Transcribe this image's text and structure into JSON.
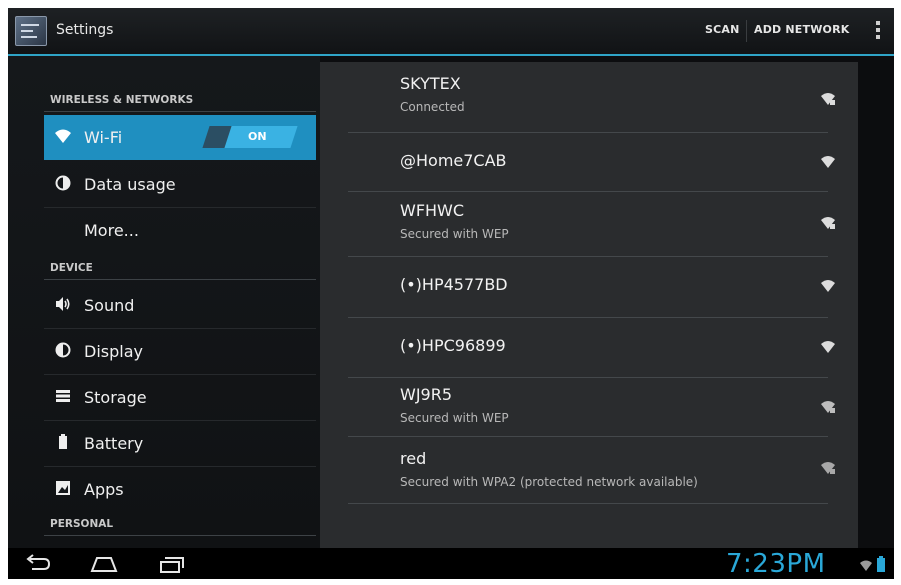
{
  "action_bar": {
    "title": "Settings",
    "scan_label": "SCAN",
    "add_network_label": "ADD NETWORK"
  },
  "sidebar": {
    "sections": [
      {
        "header": "WIRELESS & NETWORKS"
      },
      {
        "header": "DEVICE"
      },
      {
        "header": "PERSONAL"
      }
    ],
    "items": [
      {
        "label": "Wi-Fi",
        "icon": "wifi-icon",
        "selected": true
      },
      {
        "label": "Data usage",
        "icon": "data-usage-icon"
      },
      {
        "label": "More..."
      },
      {
        "label": "Sound",
        "icon": "speaker-icon"
      },
      {
        "label": "Display",
        "icon": "display-icon"
      },
      {
        "label": "Storage",
        "icon": "storage-icon"
      },
      {
        "label": "Battery",
        "icon": "battery-icon"
      },
      {
        "label": "Apps",
        "icon": "apps-icon"
      }
    ],
    "wifi_toggle": {
      "label": "ON",
      "state": "on"
    }
  },
  "networks": [
    {
      "name": "SKYTEX",
      "status": "Connected",
      "secured": true
    },
    {
      "name": "@Home7CAB",
      "status": "",
      "secured": false
    },
    {
      "name": "WFHWC",
      "status": "Secured with WEP",
      "secured": true
    },
    {
      "name": "(•)HP4577BD",
      "status": "",
      "secured": false
    },
    {
      "name": "(•)HPC96899",
      "status": "",
      "secured": false
    },
    {
      "name": "WJ9R5",
      "status": "Secured with WEP",
      "secured": true
    },
    {
      "name": "red",
      "status": "Secured with WPA2 (protected network available)",
      "secured": true
    }
  ],
  "system_bar": {
    "time": "7:23PM"
  },
  "colors": {
    "accent": "#1f8fc0",
    "toggle_on": "#3ab2e3",
    "clock": "#2aa8d8"
  }
}
